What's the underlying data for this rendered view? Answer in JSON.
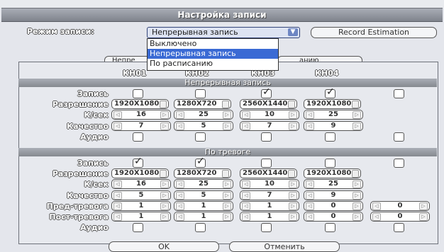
{
  "title": "Настройка записи",
  "mode_label": "Режим записи:",
  "mode_value": "Непрерывная запись",
  "estimation_button": "Record Estimation",
  "dropdown_options": [
    "Выключено",
    "Непрерывная запись",
    "По расписанию"
  ],
  "dropdown_selected_index": 1,
  "tab_left": "Непре",
  "tab_right": "анию",
  "channels": [
    "КН01",
    "КН02",
    "КН03",
    "КН04"
  ],
  "section1": {
    "title": "Непрерывная запись",
    "labels": {
      "record": "Запись",
      "resolution": "Разрешение",
      "fps": "К/сек",
      "quality": "Качество",
      "audio": "Аудио"
    },
    "record": [
      false,
      false,
      true,
      true
    ],
    "record_all": false,
    "resolution": [
      "1920X1080",
      "1280X720",
      "2560X1440",
      "1920X1080"
    ],
    "fps": [
      "16",
      "25",
      "10",
      "25"
    ],
    "quality": [
      "7",
      "5",
      "7",
      "9"
    ],
    "audio": [
      false,
      false,
      false,
      false
    ],
    "audio_all": false
  },
  "section2": {
    "title": "По тревоге",
    "labels": {
      "record": "Запись",
      "resolution": "Разрешение",
      "fps": "К/сек",
      "quality": "Качество",
      "pre": "Пред-тревога",
      "post": "Пост-тревога",
      "audio": "Аудио"
    },
    "record": [
      true,
      true,
      false,
      false
    ],
    "record_all": false,
    "resolution": [
      "1920X1080",
      "1280X720",
      "2560X1440",
      "1920X1080"
    ],
    "fps": [
      "16",
      "25",
      "10",
      "25"
    ],
    "quality": [
      "5",
      "5",
      "7",
      "9"
    ],
    "pre": [
      "1",
      "1",
      "1",
      "0"
    ],
    "pre_all": "0",
    "post": [
      "1",
      "1",
      "1",
      "0"
    ],
    "post_all": "0",
    "audio": [
      false,
      false,
      false,
      false
    ],
    "audio_all": false
  },
  "ok_button": "OK",
  "cancel_button": "Отменить"
}
